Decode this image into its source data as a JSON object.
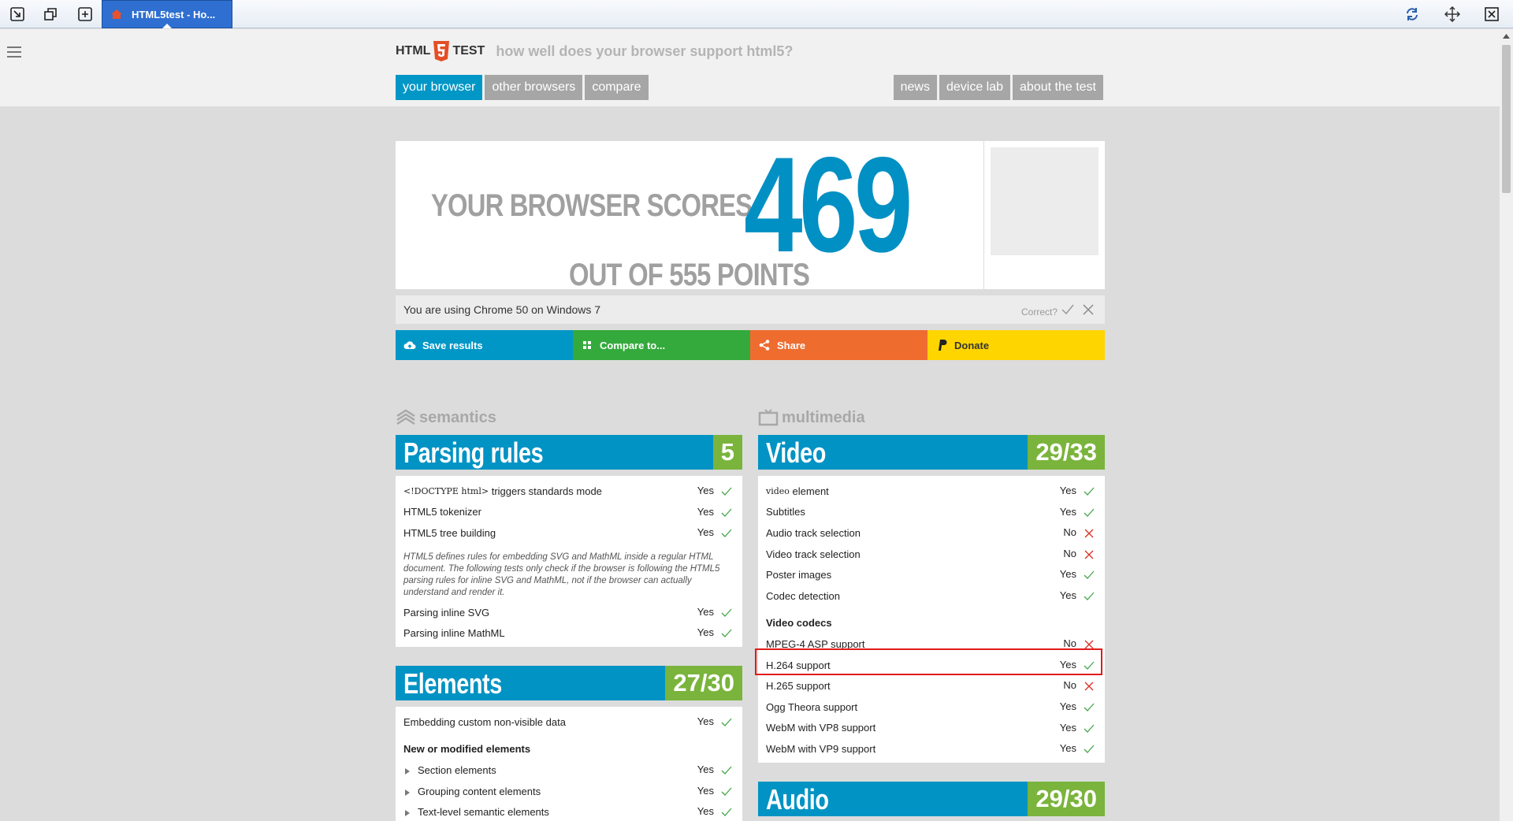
{
  "tab": {
    "title": "HTML5test - Ho..."
  },
  "header": {
    "logo_html": "HTML",
    "logo_test": "TEST",
    "tagline": "how well does your browser support html5?",
    "nav_left": [
      "your browser",
      "other browsers",
      "compare"
    ],
    "nav_right": [
      "news",
      "device lab",
      "about the test"
    ]
  },
  "score": {
    "label": "YOUR BROWSER SCORES",
    "value": "469",
    "out_of": "OUT OF 555 POINTS"
  },
  "using": {
    "text": "You are using Chrome 50 on Windows 7",
    "correct": "Correct?"
  },
  "actions": {
    "save": "Save results",
    "compare": "Compare to...",
    "share": "Share",
    "donate": "Donate"
  },
  "semantics": {
    "category": "semantics",
    "parsing": {
      "title": "Parsing rules",
      "score": "5",
      "rows": [
        {
          "code": "<!DOCTYPE html>",
          "label": "triggers standards mode",
          "result": "Yes"
        },
        {
          "label": "HTML5 tokenizer",
          "result": "Yes"
        },
        {
          "label": "HTML5 tree building",
          "result": "Yes"
        }
      ],
      "note": "HTML5 defines rules for embedding SVG and MathML inside a regular HTML document. The following tests only check if the browser is following the HTML5 parsing rules for inline SVG and MathML, not if the browser can actually understand and render it.",
      "rows2": [
        {
          "label": "Parsing inline SVG",
          "result": "Yes"
        },
        {
          "label": "Parsing inline MathML",
          "result": "Yes"
        }
      ]
    },
    "elements": {
      "title": "Elements",
      "score": "27/30",
      "rows": [
        {
          "label": "Embedding custom non-visible data",
          "result": "Yes"
        }
      ],
      "sub": "New or modified elements",
      "expand_rows": [
        {
          "label": "Section elements",
          "result": "Yes"
        },
        {
          "label": "Grouping content elements",
          "result": "Yes"
        },
        {
          "label": "Text-level semantic elements",
          "result": "Yes"
        }
      ]
    }
  },
  "multimedia": {
    "category": "multimedia",
    "video": {
      "title": "Video",
      "score": "29/33",
      "rows": [
        {
          "code": "video",
          "label": "element",
          "result": "Yes"
        },
        {
          "label": "Subtitles",
          "result": "Yes"
        },
        {
          "label": "Audio track selection",
          "result": "No"
        },
        {
          "label": "Video track selection",
          "result": "No"
        },
        {
          "label": "Poster images",
          "result": "Yes"
        },
        {
          "label": "Codec detection",
          "result": "Yes"
        }
      ],
      "sub": "Video codecs",
      "codecs": [
        {
          "label": "MPEG-4 ASP support",
          "result": "No"
        },
        {
          "label": "H.264 support",
          "result": "Yes"
        },
        {
          "label": "H.265 support",
          "result": "No"
        },
        {
          "label": "Ogg Theora support",
          "result": "Yes"
        },
        {
          "label": "WebM with VP8 support",
          "result": "Yes"
        },
        {
          "label": "WebM with VP9 support",
          "result": "Yes"
        }
      ]
    },
    "audio": {
      "title": "Audio",
      "score": "29/30"
    }
  },
  "colors": {
    "blue": "#0093c4",
    "green": "#7ab43c",
    "orange": "#ef6c2f",
    "yellow": "#ffd500",
    "highlight": "#e31b1b"
  }
}
